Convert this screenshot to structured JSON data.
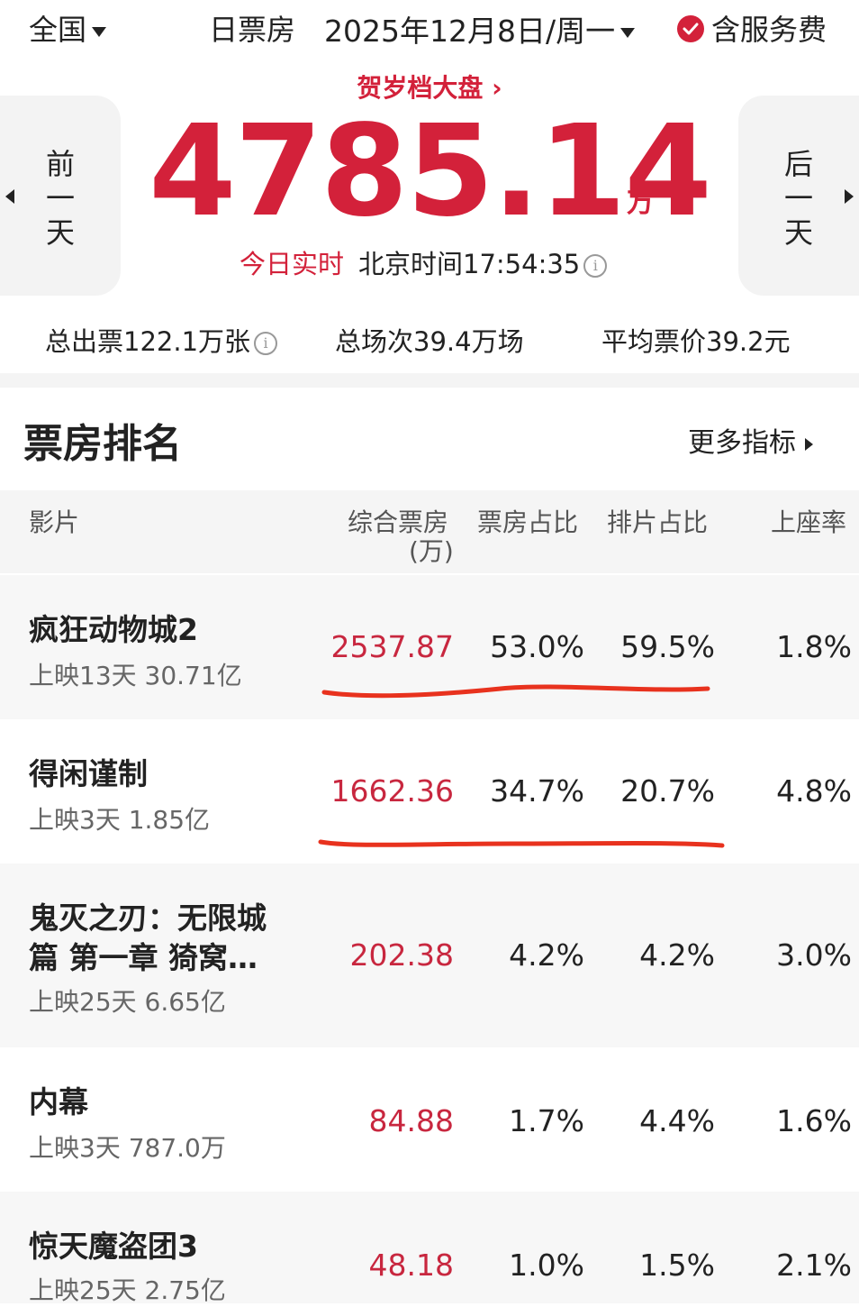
{
  "topbar": {
    "region": "全国",
    "day_label": "日票房",
    "date": "2025年12月8日/周一",
    "service_fee": "含服务费"
  },
  "hero": {
    "festival_link": "贺岁档大盘 ›",
    "prev_day": [
      "前",
      "一",
      "天"
    ],
    "next_day": [
      "后",
      "一",
      "天"
    ],
    "total": "4785.14",
    "unit": "万",
    "realtime_label": "今日实时",
    "clock": "北京时间17:54:35"
  },
  "stats": {
    "tickets": "总出票122.1万张",
    "shows": "总场次39.4万场",
    "avg_price": "平均票价39.2元"
  },
  "ranking": {
    "title": "票房排名",
    "more": "更多指标",
    "headers": {
      "film": "影片",
      "boxoffice": "综合票房",
      "boxoffice_unit": "(万)",
      "share": "票房占比",
      "schedule": "排片占比",
      "occupancy": "上座率"
    },
    "rows": [
      {
        "title": "疯狂动物城2",
        "sub": "上映13天 30.71亿",
        "boxoffice": "2537.87",
        "share": "53.0%",
        "schedule": "59.5%",
        "occupancy": "1.8%"
      },
      {
        "title": "得闲谨制",
        "sub": "上映3天 1.85亿",
        "boxoffice": "1662.36",
        "share": "34.7%",
        "schedule": "20.7%",
        "occupancy": "4.8%"
      },
      {
        "title": "鬼灭之刃：无限城",
        "title2": "篇 第一章 猗窝…",
        "sub": "上映25天 6.65亿",
        "boxoffice": "202.38",
        "share": "4.2%",
        "schedule": "4.2%",
        "occupancy": "3.0%"
      },
      {
        "title": "内幕",
        "sub": "上映3天 787.0万",
        "boxoffice": "84.88",
        "share": "1.7%",
        "schedule": "4.4%",
        "occupancy": "1.6%"
      },
      {
        "title": "惊天魔盗团3",
        "sub": "上映25天 2.75亿",
        "boxoffice": "48.18",
        "share": "1.0%",
        "schedule": "1.5%",
        "occupancy": "2.1%"
      }
    ]
  },
  "colors": {
    "accent": "#d3213a",
    "underline": "#e8321e"
  }
}
